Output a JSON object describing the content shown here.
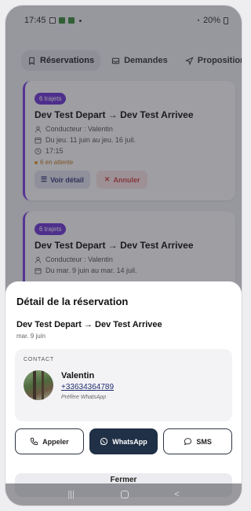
{
  "status_bar": {
    "time": "17:45",
    "battery": "20%"
  },
  "tabs": [
    {
      "label": "Réservations",
      "icon": "bookmark-icon",
      "active": true
    },
    {
      "label": "Demandes",
      "icon": "inbox-icon",
      "active": false
    },
    {
      "label": "Propositions",
      "icon": "send-icon",
      "active": false
    }
  ],
  "cards": [
    {
      "badge": "6 trajets",
      "route": "Dev Test Depart → Dev Test Arrivee",
      "driver": "Conducteur : Valentin",
      "dates": "Du jeu. 11 juin au jeu. 16 juil.",
      "time": "17:15",
      "pending": "6 en attente",
      "detail_label": "Voir détail",
      "cancel_label": "Annuler"
    },
    {
      "badge": "6 trajets",
      "route": "Dev Test Depart → Dev Test Arrivee",
      "driver": "Conducteur : Valentin",
      "dates": "Du mar. 9 juin au mar. 14 juil."
    }
  ],
  "sheet": {
    "title": "Détail de la réservation",
    "route": "Dev Test Depart → Dev Test Arrivee",
    "date": "mar. 9 juin",
    "contact": {
      "label": "CONTACT",
      "name": "Valentin",
      "phone": "+33634364789",
      "preference": "Préfère WhatsApp"
    },
    "actions": {
      "call": "Appeler",
      "whatsapp": "WhatsApp",
      "sms": "SMS"
    },
    "close_label": "Fermer"
  },
  "colors": {
    "accent": "#7b3fe4",
    "primary_dark": "#203046",
    "danger": "#d24747",
    "pending": "#e39a2e"
  }
}
